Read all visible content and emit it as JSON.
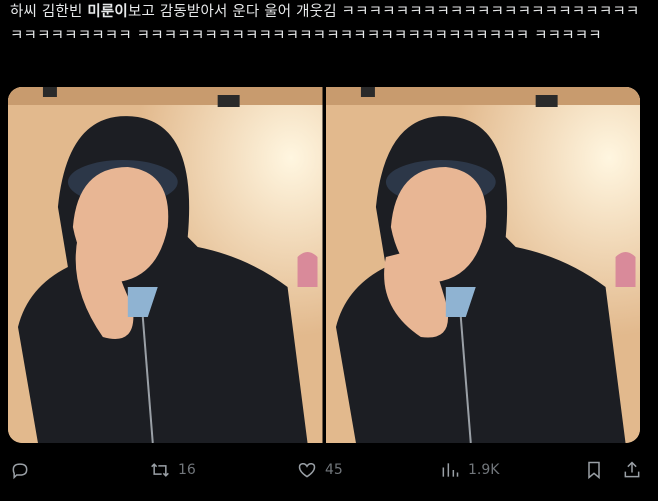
{
  "tweet": {
    "text_part1": "하씨 김한빈 ",
    "text_bold": "미룬이",
    "text_part2": "보고 감동받아서 운다 울어 개웃김 ㅋㅋㅋㅋㅋㅋㅋㅋㅋㅋㅋㅋㅋㅋㅋㅋㅋㅋㅋㅋㅋㅋㅋㅋㅋㅋㅋㅋㅋㅋㅋ ㅋㅋㅋㅋㅋㅋㅋㅋㅋㅋㅋㅋㅋㅋㅋㅋㅋㅋㅋㅋㅋㅋㅋㅋㅋㅋㅋㅋㅋ ㅋㅋㅋㅋㅋ"
  },
  "actions": {
    "reply_count": "",
    "retweet_count": "16",
    "like_count": "45",
    "view_count": "1.9K"
  },
  "icons": {
    "reply": "reply-icon",
    "retweet": "retweet-icon",
    "like": "heart-icon",
    "views": "views-icon",
    "bookmark": "bookmark-icon",
    "share": "share-icon"
  },
  "colors": {
    "background": "#000000",
    "text": "#e7e9ea",
    "muted": "#71767b"
  }
}
